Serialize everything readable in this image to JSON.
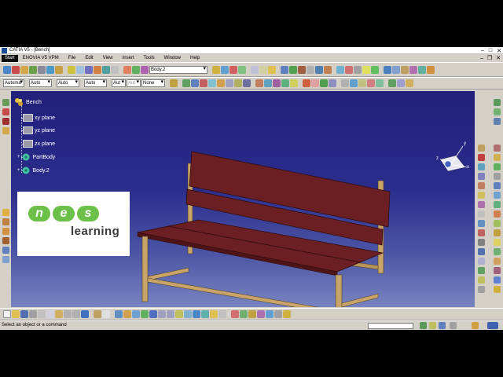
{
  "window": {
    "title": "CATIA V5 - [Bench]"
  },
  "menubar": {
    "start": "Start",
    "items": [
      "ENOVIA V5 VPM",
      "File",
      "Edit",
      "View",
      "Insert",
      "Tools",
      "Window",
      "Help"
    ]
  },
  "toolbar": {
    "body_combo": "Body.2",
    "graphic_combos": [
      "Automa",
      "Auto",
      "Auto",
      "Auto",
      "Aut",
      "Aut",
      "None"
    ]
  },
  "tree": {
    "root": "Bench",
    "items": [
      "xy plane",
      "yz plane",
      "zx plane",
      "PartBody",
      "Body.2"
    ]
  },
  "compass": {
    "axes": [
      "x",
      "y",
      "z"
    ]
  },
  "logo": {
    "letters": [
      "n",
      "e",
      "s"
    ],
    "subtitle": "learning"
  },
  "statusbar": {
    "message": "Select an object or a command"
  },
  "colors": {
    "bench_slats": "#6b1f22",
    "bench_frame": "#c9a468",
    "viewport_top": "#21207a",
    "viewport_bottom": "#7884c0",
    "logo_accent": "#6cc04a"
  }
}
